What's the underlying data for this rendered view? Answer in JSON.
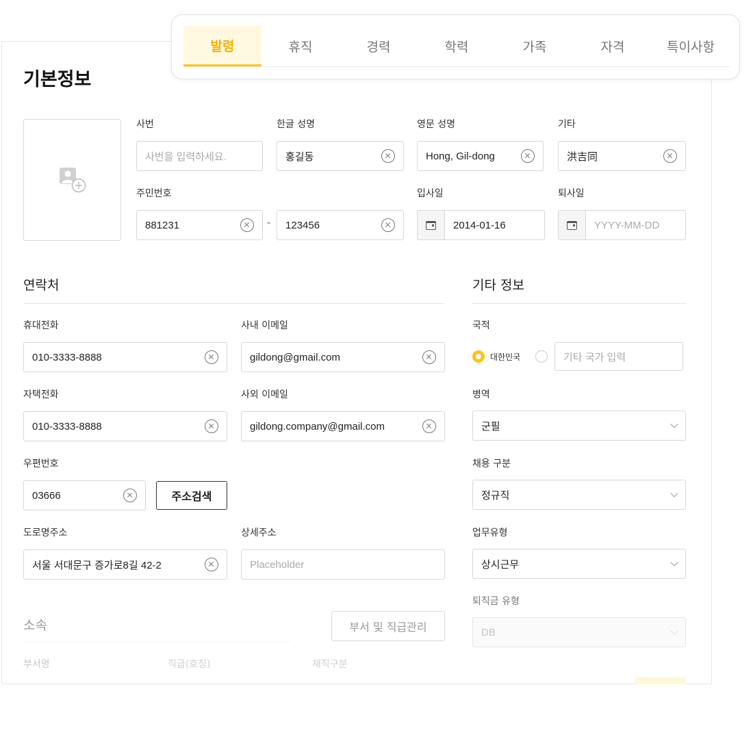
{
  "tabs": [
    "발령",
    "휴직",
    "경력",
    "학력",
    "가족",
    "자격",
    "특이사항"
  ],
  "basic": {
    "title": "기본정보",
    "emp_no_label": "사번",
    "emp_no_placeholder": "사번을 입력하세요.",
    "korean_name_label": "한글 성명",
    "korean_name_value": "홍길동",
    "english_name_label": "영문 성명",
    "english_name_value": "Hong, Gil-dong",
    "other_label": "기타",
    "other_value": "洪吉同",
    "rrn_label": "주민번호",
    "rrn_front": "881231",
    "rrn_dash": "-",
    "rrn_back": "123456",
    "join_date_label": "입사일",
    "join_date_value": "2014-01-16",
    "leave_date_label": "퇴사일",
    "leave_date_placeholder": "YYYY-MM-DD"
  },
  "contact": {
    "title": "연락처",
    "mobile_label": "휴대전화",
    "mobile_value": "010-3333-8888",
    "work_email_label": "사내 이메일",
    "work_email_value": "gildong@gmail.com",
    "home_phone_label": "자택전화",
    "home_phone_value": "010-3333-8888",
    "ext_email_label": "사외 이메일",
    "ext_email_value": "gildong.company@gmail.com",
    "zip_label": "우편번호",
    "zip_value": "03666",
    "address_search_button": "주소검색",
    "road_address_label": "도로명주소",
    "road_address_value": "서울 서대문구 증가로8길 42-2",
    "detail_address_label": "상세주소",
    "detail_address_placeholder": "Placeholder"
  },
  "affiliation": {
    "title": "소속",
    "manage_button": "부서 및 직급관리",
    "columns": [
      "부서명",
      "직급(호칭)",
      "재직구분"
    ]
  },
  "other_info": {
    "title": "기타 정보",
    "nationality_label": "국적",
    "nationality_korea": "대한민국",
    "nationality_other_placeholder": "기타 국가 입력",
    "military_label": "병역",
    "military_value": "군필",
    "hire_type_label": "채용 구분",
    "hire_type_value": "정규직",
    "work_type_label": "업무유형",
    "work_type_value": "상시근무",
    "severance_label": "퇴직금 유형",
    "severance_value": "DB"
  },
  "colors": {
    "accent": "#ffc21a",
    "accent_text": "#f5b000"
  }
}
